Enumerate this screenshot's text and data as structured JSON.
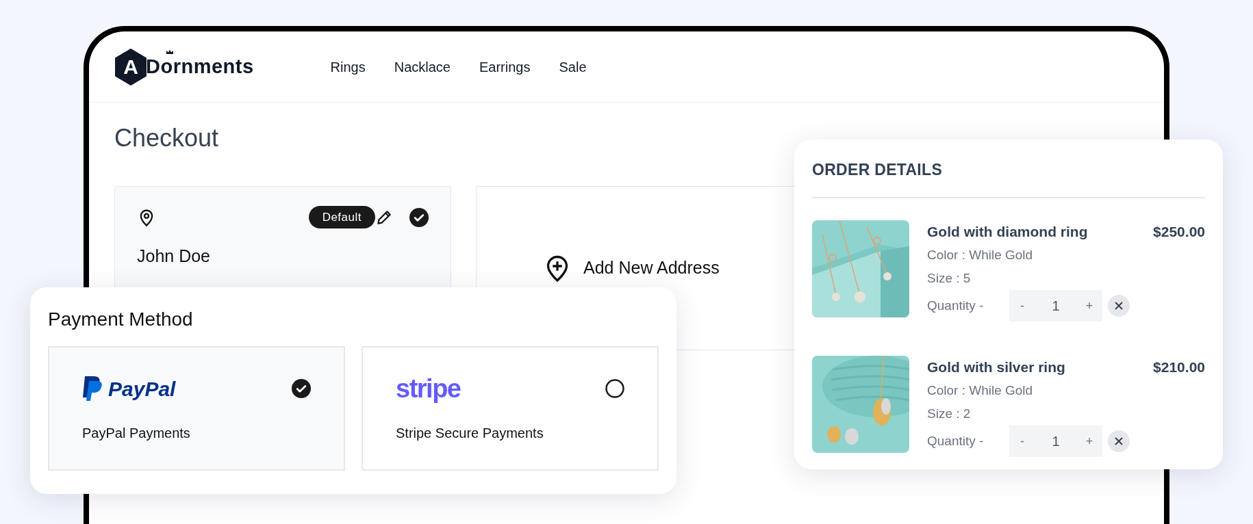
{
  "logo": {
    "letter": "A",
    "text": "Dornments"
  },
  "nav": [
    {
      "label": "Rings"
    },
    {
      "label": "Nacklace"
    },
    {
      "label": "Earrings"
    },
    {
      "label": "Sale"
    }
  ],
  "page_title": "Checkout",
  "address": {
    "name": "John Doe",
    "badge": "Default",
    "selected": true
  },
  "add_address": {
    "label": "Add New Address"
  },
  "payment": {
    "title": "Payment Method",
    "options": [
      {
        "kind": "paypal",
        "logo": "PayPal",
        "label": "PayPal Payments",
        "selected": true
      },
      {
        "kind": "stripe",
        "logo": "stripe",
        "label": "Stripe Secure Payments",
        "selected": false
      }
    ]
  },
  "order": {
    "title": "ORDER DETAILS",
    "items": [
      {
        "kind": "picture",
        "name": "Gold with diamond ring",
        "price": "$250.00",
        "color_text": "Color : While Gold",
        "size": "Size : 5",
        "quantity_label": "Quantity -",
        "minus": "-",
        "quantity": "1",
        "plus": "+"
      },
      {
        "kind": "picture",
        "name": "Gold with silver ring",
        "price": "$210.00",
        "color_text": "Color : While Gold",
        "size": "Size : 2",
        "quantity_label": "Quantity -",
        "minus": "-",
        "quantity": "1",
        "plus": "+"
      }
    ]
  }
}
